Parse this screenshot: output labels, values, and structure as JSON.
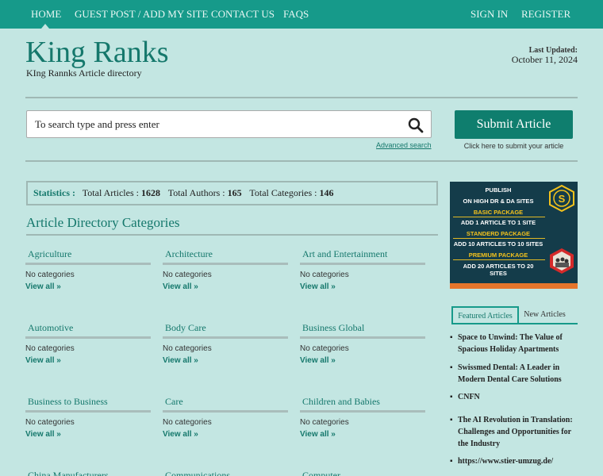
{
  "nav": {
    "home": "HOME",
    "guest_post": "GUEST POST / ADD MY SITE",
    "contact": "CONTACT US",
    "faqs": "FAQS",
    "sign_in": "SIGN IN",
    "register": "REGISTER"
  },
  "header": {
    "title": "King Ranks",
    "tagline": "KIng Rannks Article directory",
    "updated_label": "Last Updated:",
    "updated_date": "October 11, 2024"
  },
  "search": {
    "placeholder": "To search type and press enter",
    "advanced": "Advanced search",
    "icon": "search-icon"
  },
  "submit": {
    "label": "Submit Article",
    "hint": "Click here to submit your article"
  },
  "stats": {
    "label": "Statistics :",
    "articles_label": "Total Articles :",
    "articles": "1628",
    "authors_label": "Total Authors :",
    "authors": "165",
    "categories_label": "Total Categories :",
    "categories": "146"
  },
  "categories_section": {
    "title": "Article Directory Categories",
    "items": [
      {
        "name": "Agriculture",
        "empty": "No categories",
        "view": "View all »"
      },
      {
        "name": "Architecture",
        "empty": "No categories",
        "view": "View all »"
      },
      {
        "name": "Art and Entertainment",
        "empty": "No categories",
        "view": "View all »"
      },
      {
        "name": "Automotive",
        "empty": "No categories",
        "view": "View all »"
      },
      {
        "name": "Body Care",
        "empty": "No categories",
        "view": "View all »"
      },
      {
        "name": "Business Global",
        "empty": "No categories",
        "view": "View all »"
      },
      {
        "name": "Business to Business",
        "empty": "No categories",
        "view": "View all »"
      },
      {
        "name": "Care",
        "empty": "No categories",
        "view": "View all »"
      },
      {
        "name": "Children and Babies",
        "empty": "No categories",
        "view": "View all »"
      },
      {
        "name": "China Manufacturers"
      },
      {
        "name": "Communications"
      },
      {
        "name": "Computer"
      }
    ]
  },
  "ad": {
    "publish": "PUBLISH",
    "sites": "ON HIGH DR & DA SITES",
    "basic": "BASIC PACKAGE",
    "basic_desc": "ADD 1 ARTICLE TO 1 SITE",
    "standard": "STANDERD PACKAGE",
    "standard_desc": "ADD 10 ARTICLES TO 10 SITES",
    "premium": "PREMIUM PACKAGE",
    "premium_desc_1": "ADD 20 ARTICLES TO 20",
    "premium_desc_2": "SITES",
    "logo_text": "S",
    "colors": {
      "bg": "#143c4a",
      "gold": "#f4c21c",
      "accent": "#e6752b",
      "hex": "#d42a2a"
    }
  },
  "sidebar": {
    "tab_featured": "Featured Articles",
    "tab_new": "New Articles",
    "bullet": "▪",
    "articles": [
      "Space to Unwind: The Value of Spacious Holiday Apartments",
      "Swissmed Dental: A Leader in Modern Dental Care Solutions",
      "CNFN",
      "The AI Revolution in Translation: Challenges and Opportunities for the Industry",
      "https://www.stier-umzug.de/"
    ]
  },
  "colors": {
    "nav_bg": "#169a8a",
    "page_bg": "#c3e6e2",
    "accent": "#15786c",
    "button": "#0f7e6e"
  }
}
